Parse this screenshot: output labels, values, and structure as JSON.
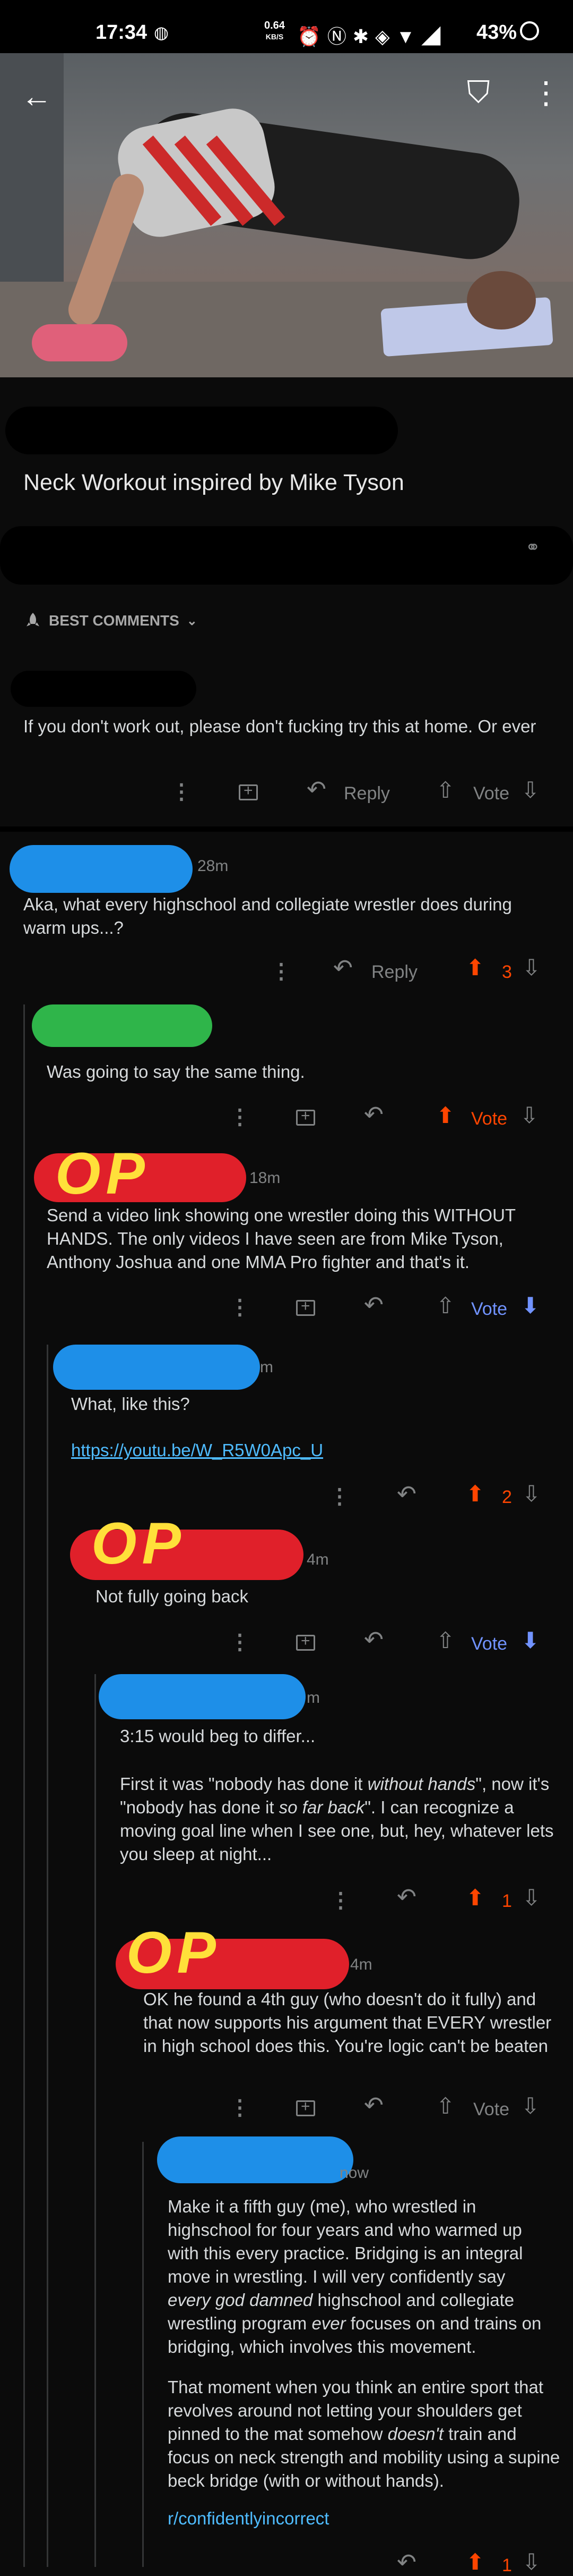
{
  "status": {
    "time": "17:34",
    "net_value": "0.64",
    "net_unit": "KB/S",
    "battery": "43%"
  },
  "post": {
    "title": "Neck Workout inspired by Mike Tyson"
  },
  "sort": {
    "label": "BEST COMMENTS"
  },
  "actions": {
    "reply": "Reply",
    "vote": "Vote"
  },
  "comments": [
    {
      "text": "If you don't work out, please don't fucking try this at home. Or ever",
      "vote_label": "Vote"
    },
    {
      "time": "28m",
      "text": "Aka, what every highschool and collegiate wrestler does during warm ups...?",
      "score": "3"
    },
    {
      "text": "Was going to say the same thing.",
      "vote_label": "Vote"
    },
    {
      "author_mark": "OP",
      "time": "18m",
      "text": "Send a video link showing one wrestler doing this WITHOUT HANDS. The only videos I have seen are from Mike Tyson, Anthony Joshua and one MMA Pro fighter and that's it.",
      "vote_label": "Vote"
    },
    {
      "time": "m",
      "text": "What, like this?",
      "link": "https://youtu.be/W_R5W0Apc_U",
      "score": "2"
    },
    {
      "author_mark": "OP",
      "time": "4m",
      "text": "Not fully going back",
      "vote_label": "Vote"
    },
    {
      "time": "m",
      "text_1": "3:15 would beg to differ...",
      "text_2a": "First it was \"nobody has done it ",
      "text_2b": "without hands",
      "text_2c": "\", now it's \"nobody has done it ",
      "text_2d": "so far back",
      "text_2e": "\". I can recognize a moving goal line when I see one, but, hey, whatever lets you sleep at night...",
      "score": "1"
    },
    {
      "author_mark": "OP",
      "time": "4m",
      "text": "OK he found a 4th guy (who doesn't do it fully) and that now supports his argument that EVERY wrestler in high school does this. You're logic can't be beaten",
      "vote_label": "Vote"
    },
    {
      "time": "now",
      "text_1a": "Make it a fifth guy (me), who wrestled in highschool for four years and who warmed up with this every practice. Bridging is an integral move in wrestling. I will very confidently say ",
      "text_1b": "every god damned",
      "text_1c": " highschool and collegiate wrestling program ",
      "text_1d": "ever",
      "text_1e": " focuses on and trains on bridging, which involves this movement.",
      "text_2a": "That moment when you think an entire sport that revolves around not letting your shoulders get pinned to the mat somehow ",
      "text_2b": "doesn't",
      "text_2c": " train and focus on neck strength and mobility using a supine beck bridge (with or without hands).",
      "link": "r/confidentlyincorrect",
      "score": "1"
    }
  ],
  "colors": {
    "upvote": "#ff4500",
    "downvote": "#7193ff",
    "link": "#4fbcff",
    "redact_blue": "#1e8fe8",
    "redact_green": "#2fb54a",
    "op_red": "#e0202a",
    "op_yellow": "#ffe03a"
  }
}
